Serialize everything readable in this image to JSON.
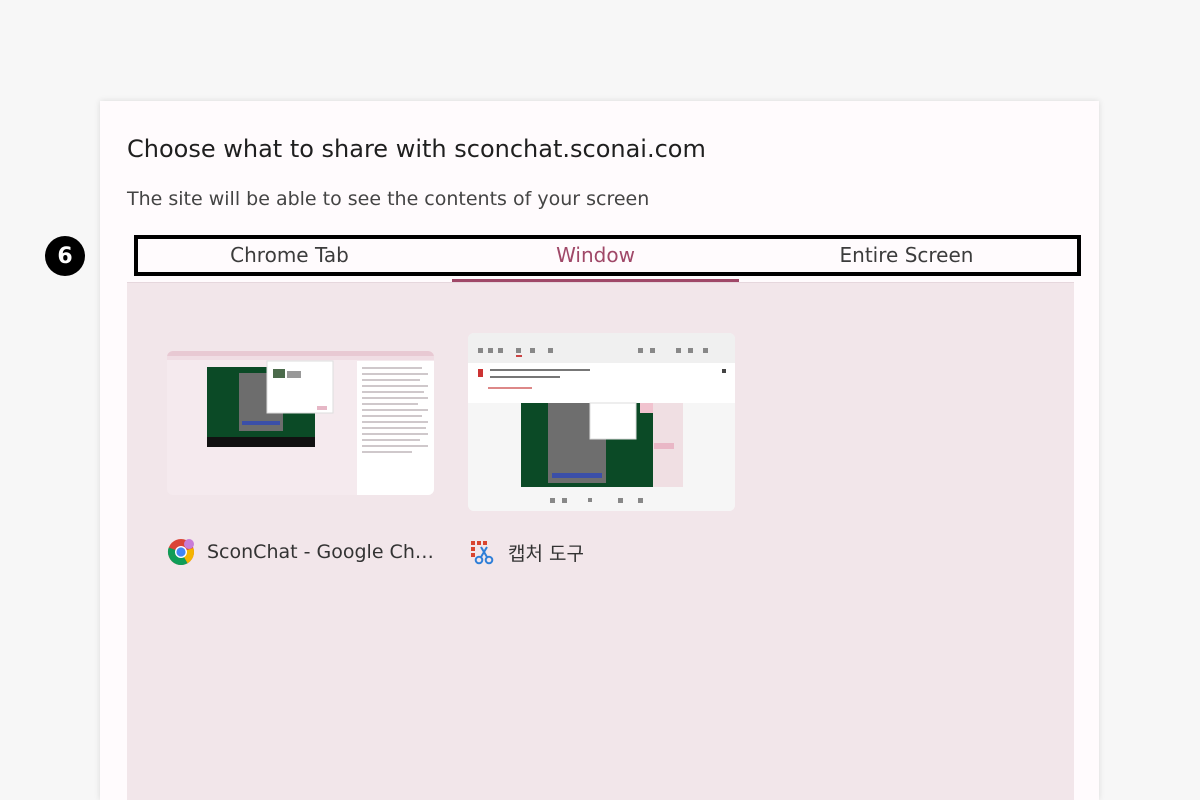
{
  "dialog": {
    "title": "Choose what to share with sconchat.sconai.com",
    "subtitle": "The site will be able to see the contents of your screen"
  },
  "annotation": {
    "step_number": "6"
  },
  "tabs": [
    {
      "label": "Chrome Tab",
      "active": false
    },
    {
      "label": "Window",
      "active": true
    },
    {
      "label": "Entire Screen",
      "active": false
    }
  ],
  "sources": [
    {
      "label": "SconChat - Google Chr...",
      "icon": "chrome-icon"
    },
    {
      "label": "캡처 도구",
      "icon": "snipping-tool-icon"
    }
  ],
  "colors": {
    "accent": "#a04868",
    "content_bg": "#f2e6ea",
    "thumb_green": "#0b4a26"
  }
}
